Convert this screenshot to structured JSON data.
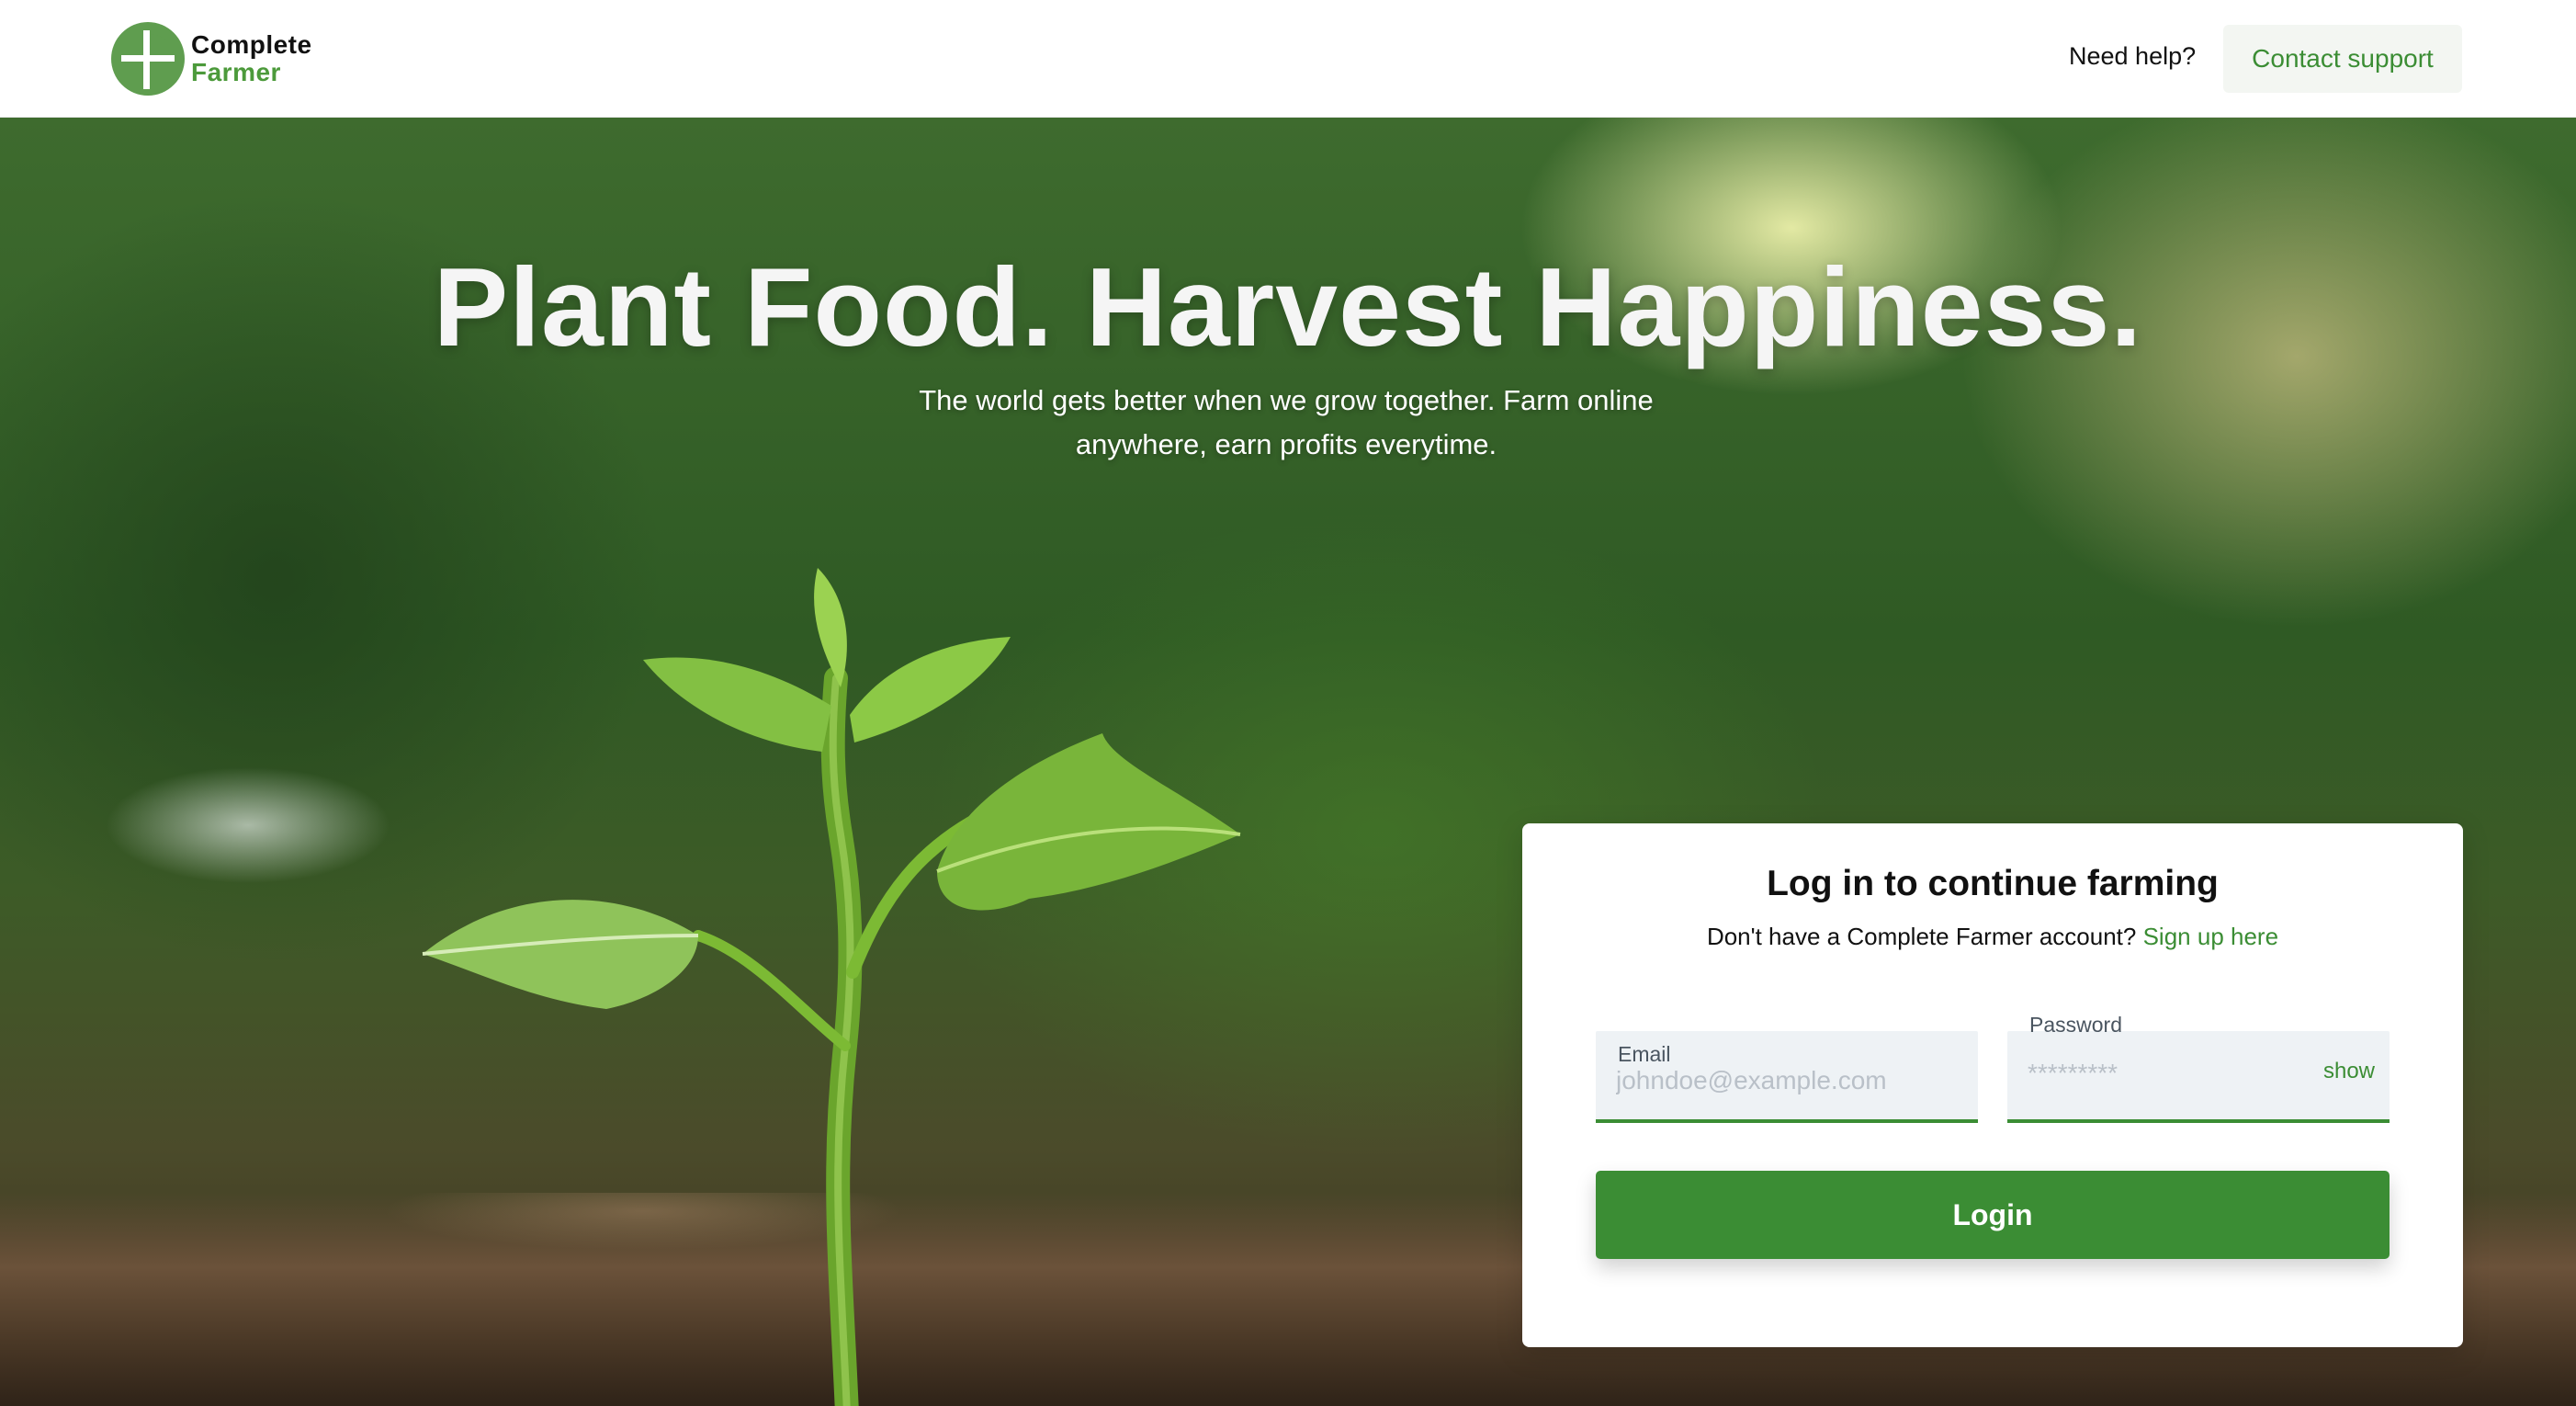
{
  "header": {
    "logo_line1": "Complete",
    "logo_line2": "Farmer",
    "need_help": "Need help?",
    "contact_support": "Contact support"
  },
  "hero": {
    "title": "Plant Food. Harvest Happiness.",
    "subtitle": "The world gets better when we grow together. Farm online anywhere, earn profits everytime."
  },
  "login_card": {
    "title": "Log in to continue farming",
    "signup_prompt": "Don't have a Complete Farmer account?",
    "signup_link": "Sign up here",
    "email_label": "Email",
    "email_placeholder": "johndoe@example.com",
    "password_label": "Password",
    "password_placeholder": "*********",
    "show_label": "show",
    "login_button": "Login"
  },
  "colors": {
    "brand_green": "#3b8d34",
    "logo_green": "#4c9a3b",
    "card_bg": "#ffffff",
    "field_bg": "#eef2f5"
  },
  "icons": {
    "logo": "complete-farmer-logo-icon"
  }
}
